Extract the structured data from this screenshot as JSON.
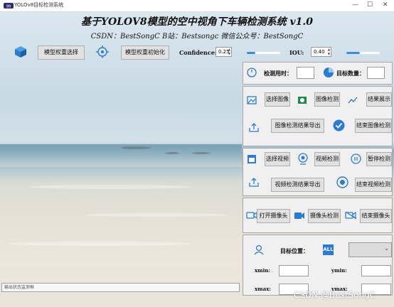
{
  "window": {
    "title": "YOLOv8目标检测系统"
  },
  "header": {
    "title": "基于YOLOV8模型的空中视角下车辆检测系统 v1.0",
    "subtitle": "CSDN：BestSongC   B站：Bestsongc   微信公众号：BestSongC"
  },
  "toolbar": {
    "model_select": "模型权重选择",
    "model_init": "模型权重初始化",
    "confidence_label": "Confidence:",
    "confidence_value": "0.25",
    "confidence_level": 0.25,
    "iou_label": "IOU:",
    "iou_value": "0.40",
    "iou_level": 0.4
  },
  "stats": {
    "time_label": "检测用时：",
    "count_label": "目标数量：",
    "time_value": "",
    "count_value": ""
  },
  "image": {
    "select": "选择图像",
    "detect": "图像检测",
    "show": "结果展示",
    "export": "图像检测结果导出",
    "end": "结束图像检测"
  },
  "video": {
    "select": "选择视频",
    "detect": "视频检测",
    "pause": "暂停检测",
    "export": "视频检测结果导出",
    "end": "结束视频检测"
  },
  "camera": {
    "open": "打开摄像头",
    "detect": "摄像头检测",
    "close": "结束摄像头"
  },
  "target": {
    "label": "目标位置：",
    "all_badge": "ALL",
    "xmin": "xmin:",
    "ymin": "ymin:",
    "xmax": "xmax:",
    "ymax": "ymax:"
  },
  "status": {
    "placeholder": "输出状态监测框"
  },
  "watermark": "CSDN @BestSongC",
  "colors": {
    "accent": "#3c8fd6",
    "icon_blue": "#2a7bd3",
    "window_bg": "#f0f0f0"
  }
}
